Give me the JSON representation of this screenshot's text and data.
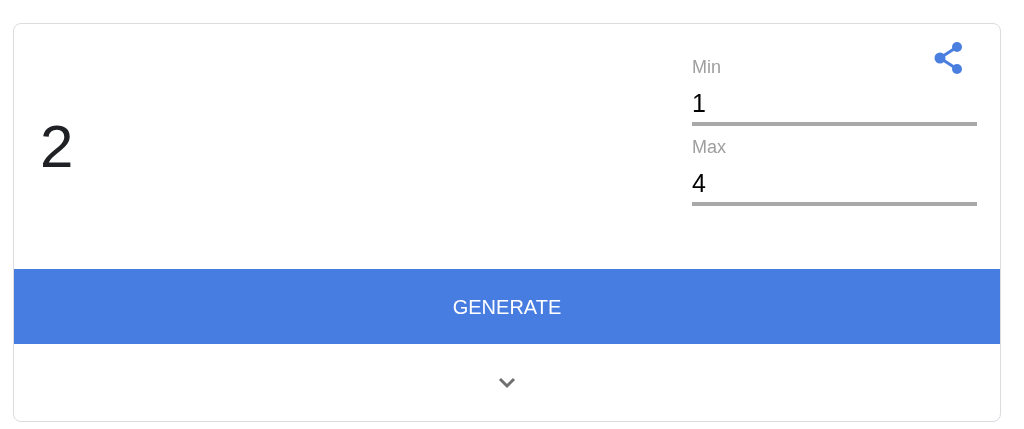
{
  "result": "2",
  "fields": [
    {
      "label": "Min",
      "value": "1"
    },
    {
      "label": "Max",
      "value": "4"
    }
  ],
  "button": "GENERATE"
}
